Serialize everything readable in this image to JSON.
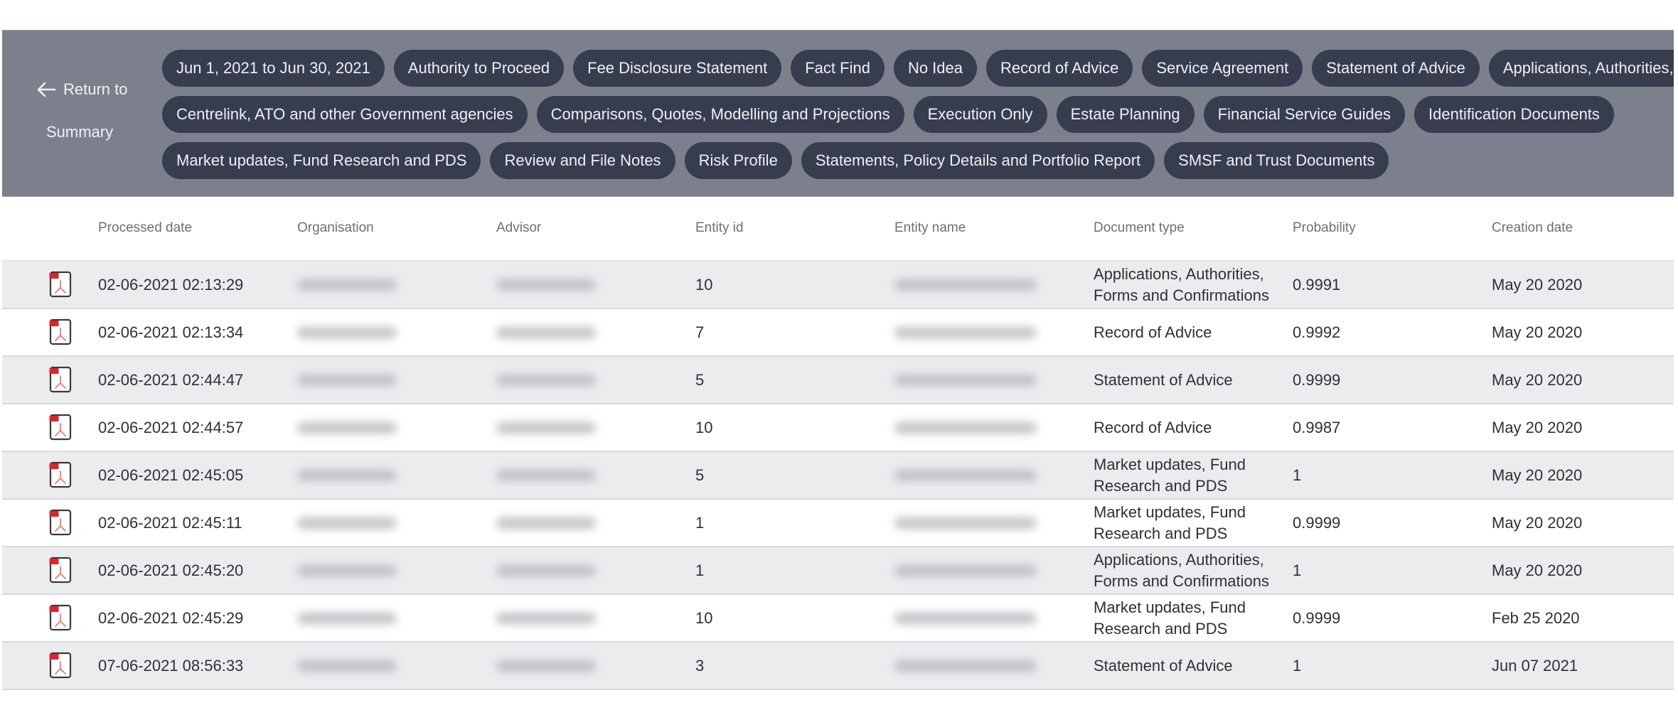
{
  "filter_bar": {
    "return_button": {
      "line1": "Return to",
      "line2": "Summary",
      "icon": "arrow-left-icon"
    },
    "chip_rows": [
      [
        "Jun 1, 2021 to Jun 30, 2021",
        "Authority to Proceed",
        "Fee Disclosure Statement",
        "Fact Find",
        "No Idea",
        "Record of Advice",
        "Service Agreement",
        "Statement of Advice",
        "Applications, Authorities, Forms and Confirmations"
      ],
      [
        "Centrelink, ATO and other Government agencies",
        "Comparisons, Quotes, Modelling and Projections",
        "Execution Only",
        "Estate Planning",
        "Financial Service Guides",
        "Identification Documents"
      ],
      [
        "Market updates, Fund Research and PDS",
        "Review and File Notes",
        "Risk Profile",
        "Statements, Policy Details and Portfolio Report",
        "SMSF and Trust Documents"
      ]
    ]
  },
  "colors": {
    "band": "#7c7f8c",
    "chip": "#383c4f",
    "row_stripe": "#ececef",
    "pdf_red": "#d8262f"
  },
  "table": {
    "columns": [
      "Processed date",
      "Organisation",
      "Advisor",
      "Entity id",
      "Entity name",
      "Document type",
      "Probability",
      "Creation date"
    ],
    "rows": [
      {
        "icon": "pdf-file-icon",
        "processed_date": "02-06-2021 02:13:29",
        "organisation": "[redacted]",
        "advisor": "[redacted]",
        "entity_id": "10",
        "entity_name": "[redacted]",
        "document_type": "Applications, Authorities, Forms and Confirmations",
        "probability": "0.9991",
        "creation_date": "May 20 2020"
      },
      {
        "icon": "pdf-file-icon",
        "processed_date": "02-06-2021 02:13:34",
        "organisation": "[redacted]",
        "advisor": "[redacted]",
        "entity_id": "7",
        "entity_name": "[redacted]",
        "document_type": "Record of Advice",
        "probability": "0.9992",
        "creation_date": "May 20 2020"
      },
      {
        "icon": "pdf-file-icon",
        "processed_date": "02-06-2021 02:44:47",
        "organisation": "[redacted]",
        "advisor": "[redacted]",
        "entity_id": "5",
        "entity_name": "[redacted]",
        "document_type": "Statement of Advice",
        "probability": "0.9999",
        "creation_date": "May 20 2020"
      },
      {
        "icon": "pdf-file-icon",
        "processed_date": "02-06-2021 02:44:57",
        "organisation": "[redacted]",
        "advisor": "[redacted]",
        "entity_id": "10",
        "entity_name": "[redacted]",
        "document_type": "Record of Advice",
        "probability": "0.9987",
        "creation_date": "May 20 2020"
      },
      {
        "icon": "pdf-file-icon",
        "processed_date": "02-06-2021 02:45:05",
        "organisation": "[redacted]",
        "advisor": "[redacted]",
        "entity_id": "5",
        "entity_name": "[redacted]",
        "document_type": "Market updates, Fund Research and PDS",
        "probability": "1",
        "creation_date": "May 20 2020"
      },
      {
        "icon": "pdf-file-icon",
        "processed_date": "02-06-2021 02:45:11",
        "organisation": "[redacted]",
        "advisor": "[redacted]",
        "entity_id": "1",
        "entity_name": "[redacted]",
        "document_type": "Market updates, Fund Research and PDS",
        "probability": "0.9999",
        "creation_date": "May 20 2020"
      },
      {
        "icon": "pdf-file-icon",
        "processed_date": "02-06-2021 02:45:20",
        "organisation": "[redacted]",
        "advisor": "[redacted]",
        "entity_id": "1",
        "entity_name": "[redacted]",
        "document_type": "Applications, Authorities, Forms and Confirmations",
        "probability": "1",
        "creation_date": "May 20 2020"
      },
      {
        "icon": "pdf-file-icon",
        "processed_date": "02-06-2021 02:45:29",
        "organisation": "[redacted]",
        "advisor": "[redacted]",
        "entity_id": "10",
        "entity_name": "[redacted]",
        "document_type": "Market updates, Fund Research and PDS",
        "probability": "0.9999",
        "creation_date": "Feb 25 2020"
      },
      {
        "icon": "pdf-file-icon",
        "processed_date": "07-06-2021 08:56:33",
        "organisation": "[redacted]",
        "advisor": "[redacted]",
        "entity_id": "3",
        "entity_name": "[redacted]",
        "document_type": "Statement of Advice",
        "probability": "1",
        "creation_date": "Jun 07 2021"
      }
    ]
  }
}
